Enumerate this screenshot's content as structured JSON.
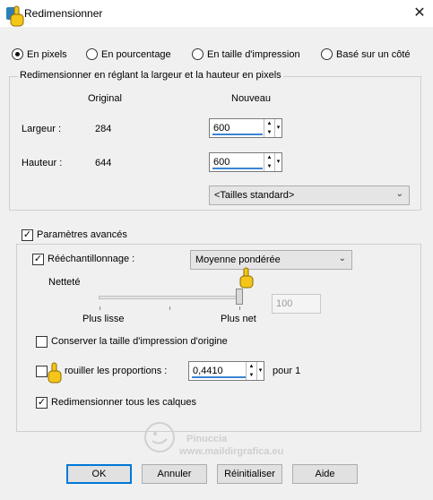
{
  "window": {
    "title": "Redimensionner",
    "close_glyph": "✕"
  },
  "modes": [
    {
      "label": "En pixels",
      "selected": true
    },
    {
      "label": "En pourcentage",
      "selected": false
    },
    {
      "label": "En taille d'impression",
      "selected": false
    },
    {
      "label": "Basé sur un côté",
      "selected": false
    }
  ],
  "pixel_group": {
    "title": "Redimensionner en réglant la largeur et la hauteur en pixels",
    "col_original": "Original",
    "col_nouveau": "Nouveau",
    "width_label": "Largeur :",
    "width_original": "284",
    "width_new": "600",
    "height_label": "Hauteur :",
    "height_original": "644",
    "height_new": "600",
    "standard_sizes": "<Tailles standard>"
  },
  "advanced": {
    "label": "Paramètres avancés",
    "checked": true,
    "resample_label": "Rééchantillonnage :",
    "resample_checked": true,
    "resample_method": "Moyenne pondérée",
    "sharpness_label": "Netteté",
    "slider_min_label": "Plus lisse",
    "slider_max_label": "Plus net",
    "sharpness_value": "100",
    "sharpness_level": 1.0,
    "keep_print_size_label": "Conserver la taille d'impression d'origine",
    "keep_print_size_checked": false,
    "lock_ratio_label": "rouiller les proportions :",
    "lock_ratio_checked": false,
    "ratio_value": "0,4410",
    "ratio_suffix": "pour 1",
    "resize_all_layers_label": "Redimensionner tous les calques",
    "resize_all_layers_checked": true
  },
  "buttons": {
    "ok": "OK",
    "cancel": "Annuler",
    "reset": "Réinitialiser",
    "help": "Aide"
  },
  "watermark": {
    "line1": "Pinuccia",
    "line2": "www.maildirgrafica.eu"
  },
  "colors": {
    "accent": "#0078d7",
    "underline": "#3b84d4",
    "hand": "#f5c518"
  }
}
